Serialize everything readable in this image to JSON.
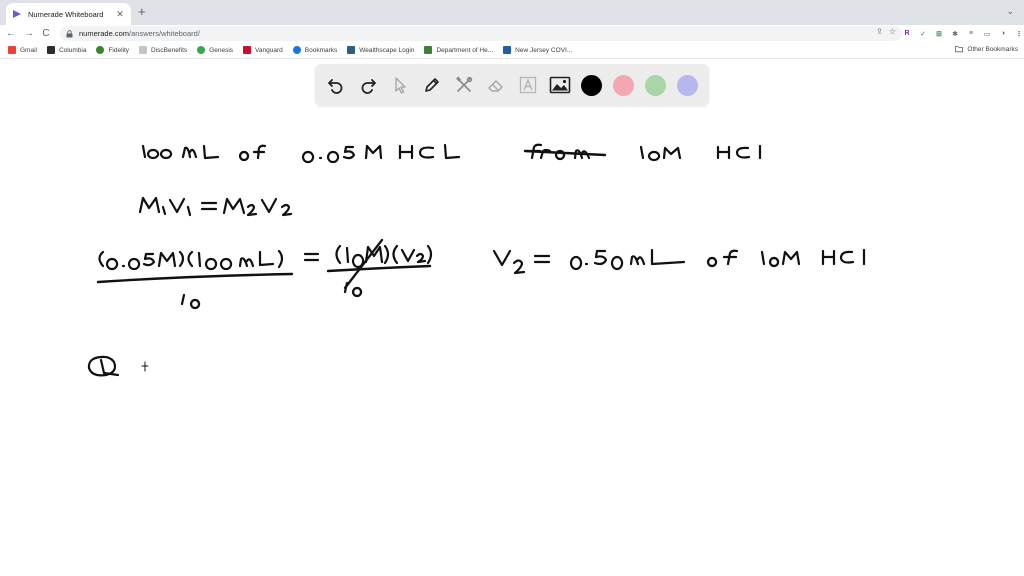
{
  "browser": {
    "tab": {
      "title": "Numerade Whiteboard",
      "close": "✕"
    },
    "new_tab": "+",
    "window_menu": "⌄",
    "nav": {
      "back": "←",
      "forward": "→",
      "reload": "C"
    },
    "address": {
      "host": "numerade.com",
      "path": "/answers/whiteboard/"
    },
    "omnibox_actions": [
      "⇪",
      "☆"
    ],
    "extensions": [
      {
        "label": "R",
        "color": "#7a2bd1"
      },
      {
        "label": "✓",
        "color": "#1e8e3e"
      },
      {
        "label": "⊞",
        "color": "#188038"
      },
      {
        "label": "✱",
        "color": "#5f6368"
      },
      {
        "label": "≡",
        "color": "#5f6368"
      },
      {
        "label": "▭",
        "color": "#5f6368"
      },
      {
        "label": "◑",
        "color": "#5f6368"
      },
      {
        "label": "⋮",
        "color": "#5f6368"
      }
    ]
  },
  "bookmarks": [
    {
      "label": "Gmail",
      "icon": "gmail-icon",
      "color": "#ea4335"
    },
    {
      "label": "Columbia",
      "icon": "columbia-icon",
      "color": "#2d2d2d"
    },
    {
      "label": "Fidelity",
      "icon": "fidelity-icon",
      "color": "#368727"
    },
    {
      "label": "DiscBenefits",
      "icon": "page-icon",
      "color": "#c5c5c5"
    },
    {
      "label": "Genesis",
      "icon": "google-icon",
      "color": "#34a853"
    },
    {
      "label": "Vanguard",
      "icon": "vanguard-icon",
      "color": "#c8102e"
    },
    {
      "label": "Bookmarks",
      "icon": "star-icon",
      "color": "#1a73e8"
    },
    {
      "label": "Wealthscape Login",
      "icon": "wealthscape-icon",
      "color": "#2a5f8a"
    },
    {
      "label": "Department of He...",
      "icon": "nj-icon",
      "color": "#3f7f3a"
    },
    {
      "label": "New Jersey COVI...",
      "icon": "nj-icon",
      "color": "#1f5fa8"
    }
  ],
  "other_bookmarks": "Other Bookmarks",
  "tools": [
    {
      "name": "undo-icon",
      "interactable": true
    },
    {
      "name": "redo-icon",
      "interactable": true
    },
    {
      "name": "pointer-icon",
      "interactable": true
    },
    {
      "name": "pen-icon",
      "interactable": true
    },
    {
      "name": "tools-icon",
      "interactable": true
    },
    {
      "name": "eraser-icon",
      "interactable": true
    },
    {
      "name": "text-icon",
      "interactable": true
    },
    {
      "name": "image-icon",
      "interactable": true
    }
  ],
  "swatches": [
    "#000000",
    "#f4a7b3",
    "#a9d5a7",
    "#b8b6ef"
  ],
  "ink_color": "#111111"
}
